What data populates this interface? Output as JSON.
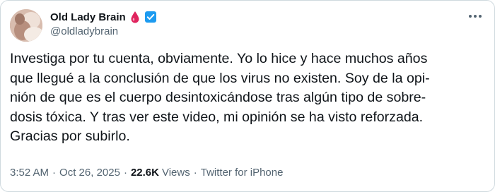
{
  "author": {
    "display_name": "Old Lady Brain",
    "handle": "@oldladybrain",
    "emoji_icon": "blood-drop-icon",
    "verified_icon": "verified-badge-icon",
    "verified_color": "#1d9bf0"
  },
  "more_icon": "more-horizontal-icon",
  "tweet": {
    "lines": [
      "Investiga por tu cuenta, obviamente. Yo lo hice y hace muchos años",
      "que llegué a la conclusión de que los virus no existen. Soy de la opi-",
      "nión de que es el cuerpo desintoxicándose tras algún tipo de sobre-",
      "dosis tóxica. Y tras ver este video, mi opinión se ha visto reforzada.",
      "Gracias por subirlo."
    ]
  },
  "meta": {
    "time": "3:52 AM",
    "date": "Oct 26, 2025",
    "separator": "·",
    "views_count": "22.6K",
    "views_label": "Views",
    "source": "Twitter for iPhone"
  },
  "colors": {
    "text": "#0f1419",
    "secondary": "#536471",
    "border": "#cfd9de",
    "accent": "#1d9bf0",
    "drop": "#e0245e"
  }
}
